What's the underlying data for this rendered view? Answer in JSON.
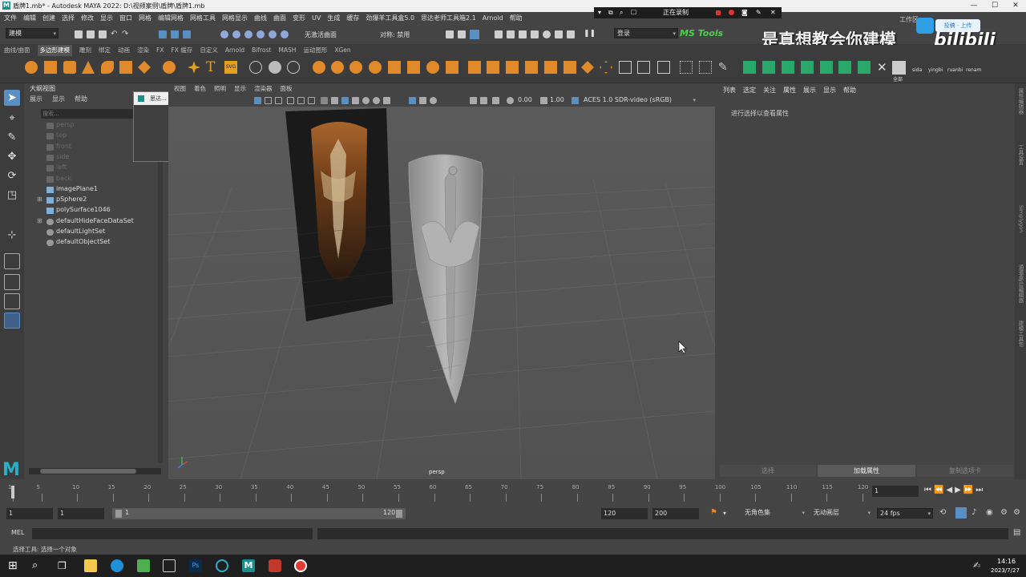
{
  "window": {
    "title": "盾牌1.mb* - Autodesk MAYA 2022: D:\\视频案例\\盾牌\\盾牌1.mb",
    "logo_letter": "M",
    "min": "—",
    "max": "☐",
    "close": "✕"
  },
  "menubar": {
    "items": [
      "文件",
      "编辑",
      "创建",
      "选择",
      "修改",
      "显示",
      "窗口",
      "网格",
      "编辑网格",
      "网格工具",
      "网格显示",
      "曲线",
      "曲面",
      "变形",
      "UV",
      "生成",
      "缓存",
      "劲爆羊工具盒5.0",
      "思达老师工具箱2.1",
      "Arnold",
      "帮助"
    ]
  },
  "statusline": {
    "mode": "建模",
    "symmetry": "对称: 禁用",
    "no_live": "无激活曲面",
    "login": "登录",
    "ms_tools": "MS Tools",
    "workspace": "工作区"
  },
  "recording": {
    "label": "正在录制"
  },
  "watermark": {
    "text": "是真想教会你建模",
    "bili": "bilibili",
    "cast_button": "投稿 · 上传"
  },
  "shelf": {
    "tabs": [
      "曲线/曲面",
      "多边形建模",
      "雕刻",
      "绑定",
      "动画",
      "渲染",
      "FX",
      "FX 缓存",
      "自定义",
      "Arnold",
      "Bifrost",
      "MASH",
      "运动图形",
      "XGen"
    ],
    "active_tab": "多边形建模",
    "labels": [
      "全部",
      "sida",
      "yingbi",
      "ruanbi",
      "renam"
    ]
  },
  "outliner": {
    "title": "大纲视图",
    "menu": [
      "展示",
      "显示",
      "帮助"
    ],
    "search_placeholder": "搜索...",
    "items": [
      {
        "label": "persp",
        "dim": true
      },
      {
        "label": "top",
        "dim": true
      },
      {
        "label": "front",
        "dim": true
      },
      {
        "label": "side",
        "dim": true
      },
      {
        "label": "left",
        "dim": true
      },
      {
        "label": "back",
        "dim": true
      },
      {
        "label": "imagePlane1",
        "dim": false
      },
      {
        "label": "pSphere2",
        "dim": false
      },
      {
        "label": "polySurface1046",
        "dim": false
      },
      {
        "label": "defaultHideFaceDataSet",
        "dim": false
      },
      {
        "label": "defaultLightSet",
        "dim": false
      },
      {
        "label": "defaultObjectSet",
        "dim": false
      }
    ]
  },
  "float_window": {
    "title": "思达..."
  },
  "viewport": {
    "menu": [
      "视图",
      "着色",
      "照明",
      "显示",
      "渲染器",
      "面板"
    ],
    "exposure": "0.00",
    "gamma": "1.00",
    "color_space": "ACES 1.0 SDR-video (sRGB)",
    "camera_label": "persp"
  },
  "attribute_editor": {
    "menu": [
      "列表",
      "选定",
      "关注",
      "属性",
      "展示",
      "显示",
      "帮助"
    ],
    "hint": "进行选择以查看属性",
    "tabs": [
      "选择",
      "加载属性",
      "复制选项卡"
    ],
    "side_tabs": [
      "属性编辑器",
      "工具设置",
      "Simplygon",
      "通道盒/层编辑器",
      "建模工具包"
    ]
  },
  "timeslider": {
    "ticks": [
      "1",
      "5",
      "10",
      "15",
      "20",
      "25",
      "30",
      "35",
      "40",
      "45",
      "50",
      "55",
      "60",
      "65",
      "70",
      "75",
      "80",
      "85",
      "90",
      "95",
      "100",
      "105",
      "110",
      "115",
      "120"
    ],
    "current_frame": "1"
  },
  "range": {
    "start": "1",
    "start2": "1",
    "slider_start": "1",
    "slider_end": "120",
    "end": "120",
    "end2": "200",
    "char_set": "无角色集",
    "anim_layer": "无动画层",
    "fps": "24 fps"
  },
  "cmdline": {
    "lang": "MEL"
  },
  "helpline": {
    "text": "选择工具: 选择一个对象"
  },
  "taskbar": {
    "time": "14:16",
    "date": "2023/7/27",
    "ps_label": "Ps"
  }
}
